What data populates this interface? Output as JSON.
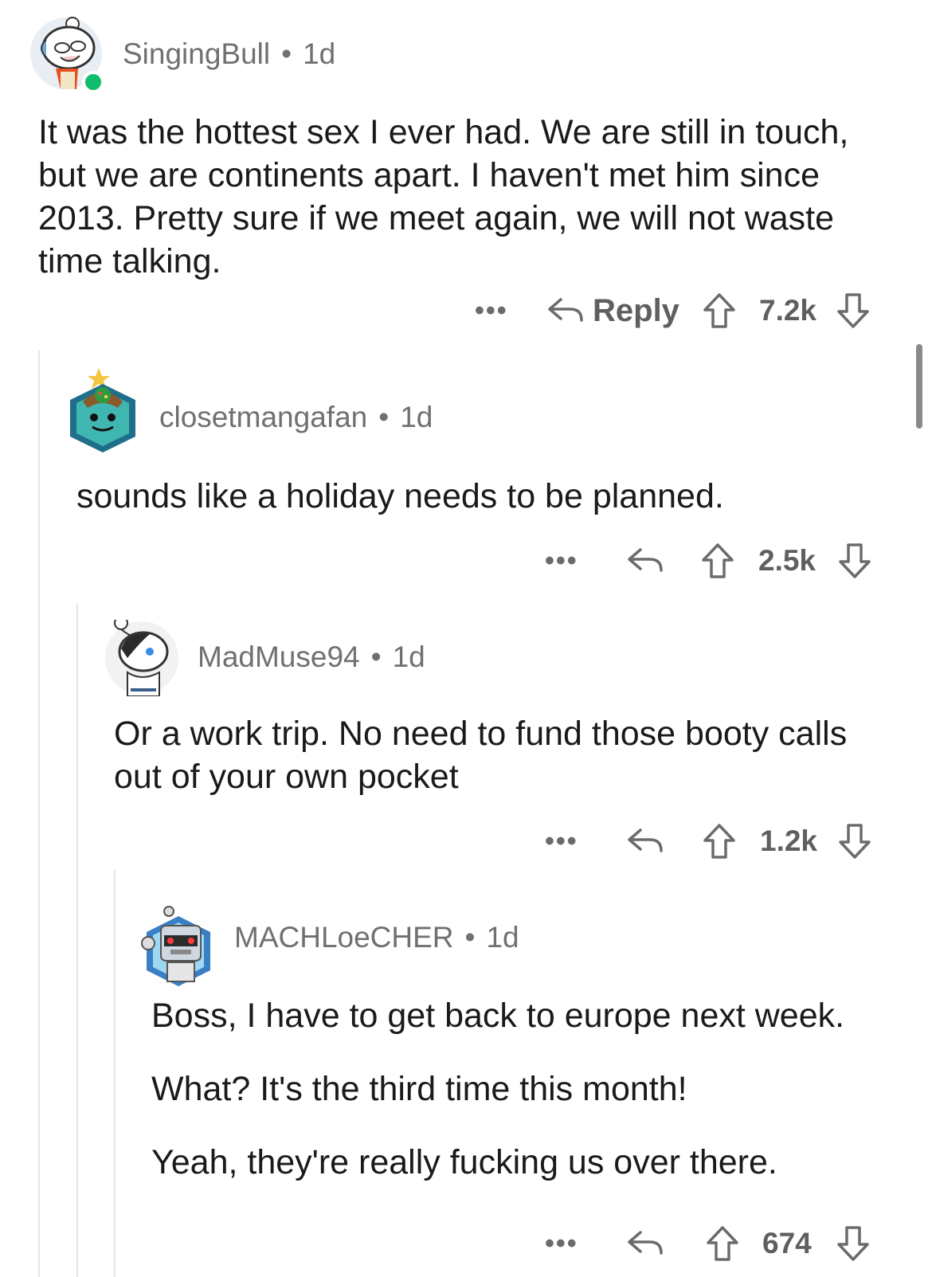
{
  "comments": [
    {
      "username": "SingingBull",
      "separator": "•",
      "age": "1d",
      "paragraphs": [
        "It was the hottest sex I ever had. We are still in touch, but we are continents apart. I haven't met him since 2013. Pretty sure if we meet again, we will not waste time talking."
      ],
      "reply_label": "Reply",
      "score": "7.2k",
      "more": "•••"
    },
    {
      "username": "closetmangafan",
      "separator": "•",
      "age": "1d",
      "paragraphs": [
        "sounds like a holiday needs to be planned."
      ],
      "score": "2.5k",
      "more": "•••"
    },
    {
      "username": "MadMuse94",
      "separator": "•",
      "age": "1d",
      "paragraphs": [
        "Or a work trip. No need to fund those booty calls out of your own pocket"
      ],
      "score": "1.2k",
      "more": "•••"
    },
    {
      "username": "MACHLoeCHER",
      "separator": "•",
      "age": "1d",
      "paragraphs": [
        "Boss, I have to get back to europe next week.",
        "What? It's the third time this month!",
        "Yeah, they're really fucking us over there."
      ],
      "score": "674",
      "more": "•••"
    }
  ],
  "icons": {
    "reply": "reply-arrow-icon",
    "upvote": "upvote-arrow-icon",
    "downvote": "downvote-arrow-icon",
    "online": "online-status-icon"
  },
  "colors": {
    "online": "#0fbd6c",
    "text": "#1a1a1b",
    "meta": "#707070",
    "thread_line": "#e4e4e4"
  }
}
